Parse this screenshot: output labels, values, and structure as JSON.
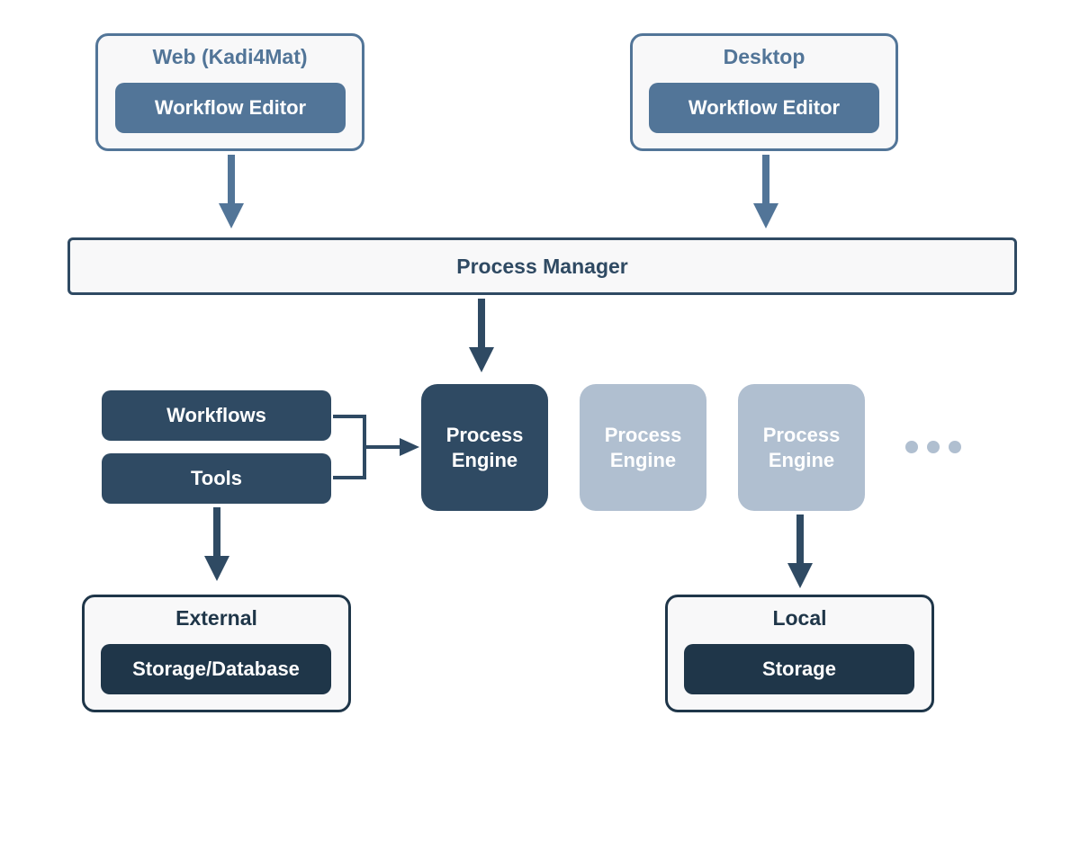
{
  "colors": {
    "blue_mid": "#527598",
    "blue_dark": "#2f4a63",
    "blue_darker": "#1f3649",
    "blue_light": "#b0bfd0",
    "group_bg": "#f8f8f9"
  },
  "web_group": {
    "title": "Web (Kadi4Mat)",
    "editor": "Workflow Editor"
  },
  "desktop_group": {
    "title": "Desktop",
    "editor": "Workflow Editor"
  },
  "process_manager": "Process Manager",
  "workflows_pill": "Workflows",
  "tools_pill": "Tools",
  "engine_active": "Process Engine",
  "engine_inactive_1": "Process Engine",
  "engine_inactive_2": "Process Engine",
  "external_group": {
    "title": "External",
    "storage": "Storage/Database"
  },
  "local_group": {
    "title": "Local",
    "storage": "Storage"
  }
}
